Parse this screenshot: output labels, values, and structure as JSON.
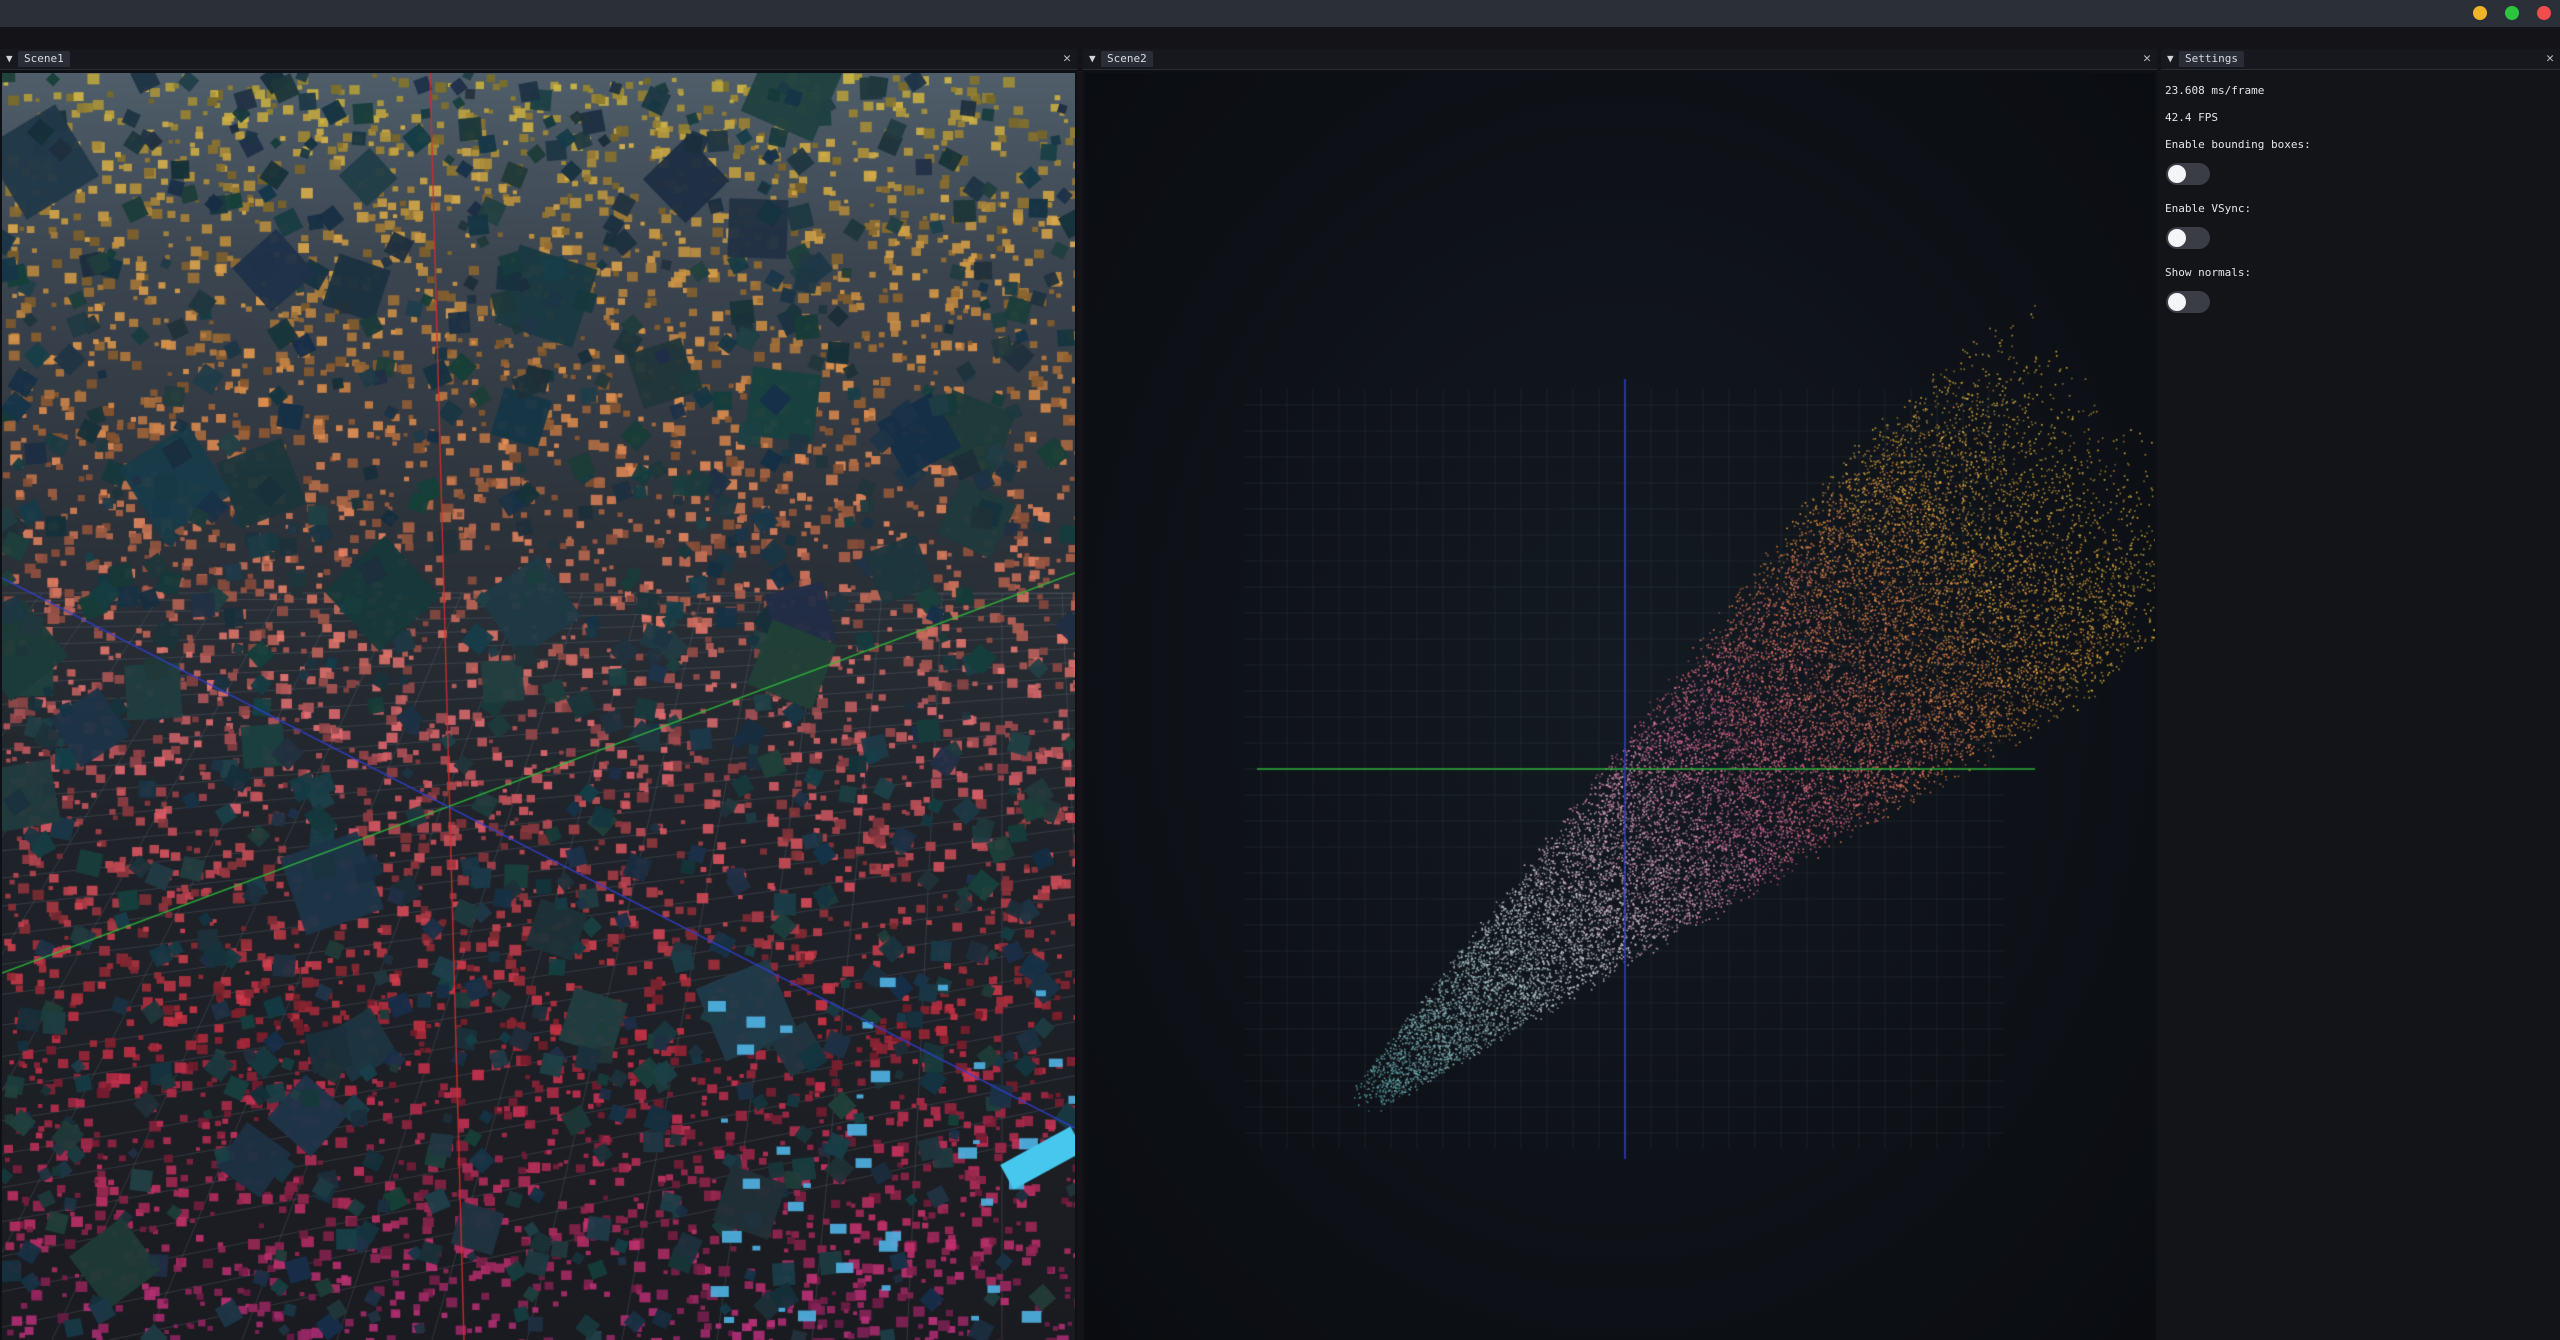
{
  "window": {
    "controls": [
      "minimize",
      "maximize",
      "close"
    ],
    "colors": {
      "minimize": "#f0b429",
      "maximize": "#2cc53f",
      "close": "#f14d4d"
    }
  },
  "panels": {
    "scene1": {
      "tab_label": "Scene1",
      "close_icon": "close-icon"
    },
    "scene2": {
      "tab_label": "Scene2",
      "close_icon": "close-icon"
    },
    "settings": {
      "tab_label": "Settings",
      "close_icon": "close-icon"
    }
  },
  "settings": {
    "frame_time": "23.608 ms/frame",
    "fps": "42.4 FPS",
    "options": [
      {
        "label": "Enable bounding boxes:",
        "enabled": false
      },
      {
        "label": "Enable VSync:",
        "enabled": false
      },
      {
        "label": "Show normals:",
        "enabled": false
      }
    ]
  },
  "colors": {
    "accent_tab": "#2a2d35",
    "toggle_off": "#3a3d45",
    "axis_x": "#2fbf3a",
    "axis_y": "#d82b2b",
    "axis_z": "#3340d8"
  }
}
